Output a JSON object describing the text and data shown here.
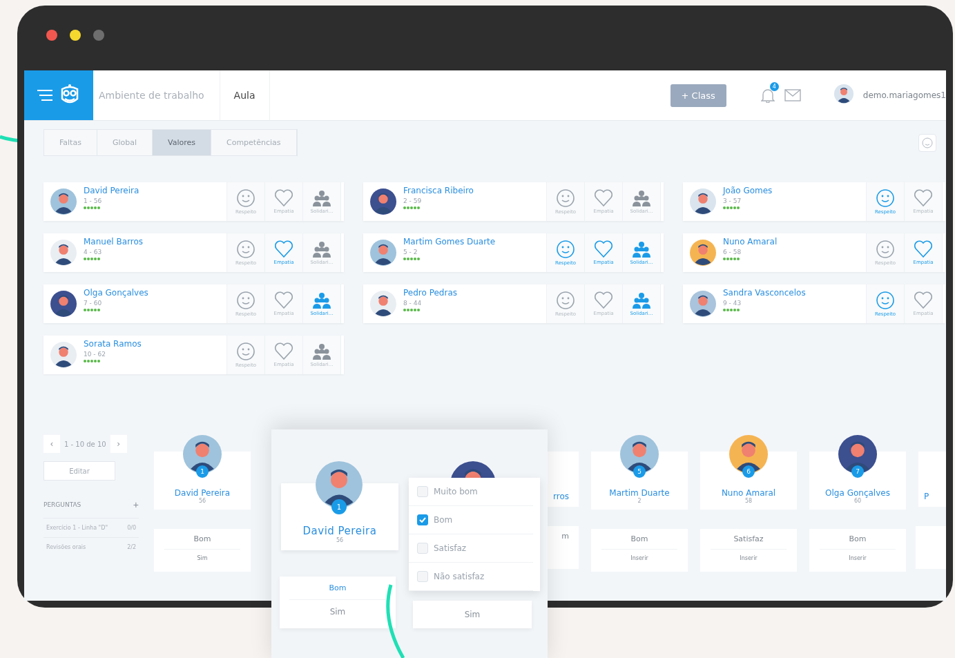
{
  "topbar": {
    "workspace": "Ambiente de trabalho",
    "section": "Aula",
    "class_button": "+ Class",
    "notifications": "4",
    "user": "demo.mariagomes1"
  },
  "tabs": [
    {
      "label": "Faltas",
      "selected": false
    },
    {
      "label": "Global",
      "selected": false
    },
    {
      "label": "Valores",
      "selected": true
    },
    {
      "label": "Competências",
      "selected": false
    }
  ],
  "students": [
    {
      "name": "David Pereira",
      "number": "1 - 56",
      "stars": 5,
      "color": "#9fc3dc",
      "values": [
        {
          "kind": "smile",
          "label": "Respeito",
          "active": false
        },
        {
          "kind": "heart",
          "label": "Empatia",
          "active": false
        },
        {
          "kind": "people",
          "label": "Solidari...",
          "active": false
        }
      ]
    },
    {
      "name": "Francisca Ribeiro",
      "number": "2 - 59",
      "stars": 5,
      "color": "#3c4f8f",
      "values": [
        {
          "kind": "smile",
          "label": "Respeito",
          "active": false
        },
        {
          "kind": "heart",
          "label": "Empatia",
          "active": false
        },
        {
          "kind": "people",
          "label": "Solidari...",
          "active": false
        }
      ]
    },
    {
      "name": "João Gomes",
      "number": "3 - 57",
      "stars": 5,
      "color": "#d9e4ee",
      "values": [
        {
          "kind": "smile",
          "label": "Respeito",
          "active": true
        },
        {
          "kind": "heart",
          "label": "Empatia",
          "active": false
        }
      ]
    },
    {
      "name": "Manuel Barros",
      "number": "4 - 63",
      "stars": 5,
      "color": "#e9eef3",
      "values": [
        {
          "kind": "smile",
          "label": "Respeito",
          "active": false
        },
        {
          "kind": "heart",
          "label": "Empatia",
          "active": true
        },
        {
          "kind": "people",
          "label": "Solidari...",
          "active": false
        }
      ]
    },
    {
      "name": "Martim Gomes Duarte",
      "number": "5 - 2",
      "stars": 5,
      "color": "#9fc3dc",
      "values": [
        {
          "kind": "smile",
          "label": "Respeito",
          "active": true
        },
        {
          "kind": "heart",
          "label": "Empatia",
          "active": true
        },
        {
          "kind": "people",
          "label": "Solidari...",
          "active": true
        }
      ]
    },
    {
      "name": "Nuno Amaral",
      "number": "6 - 58",
      "stars": 5,
      "color": "#f5b452",
      "values": [
        {
          "kind": "smile",
          "label": "Respeito",
          "active": false
        },
        {
          "kind": "heart",
          "label": "Empatia",
          "active": true
        }
      ]
    },
    {
      "name": "Olga Gonçalves",
      "number": "7 - 60",
      "stars": 5,
      "color": "#3c4f8f",
      "values": [
        {
          "kind": "smile",
          "label": "Respeito",
          "active": false
        },
        {
          "kind": "heart",
          "label": "Empatia",
          "active": false
        },
        {
          "kind": "people",
          "label": "Solidari...",
          "active": true
        }
      ]
    },
    {
      "name": "Pedro Pedras",
      "number": "8 - 44",
      "stars": 5,
      "color": "#e9eef3",
      "values": [
        {
          "kind": "smile",
          "label": "Respeito",
          "active": false
        },
        {
          "kind": "heart",
          "label": "Empatia",
          "active": false
        },
        {
          "kind": "people",
          "label": "Solidari...",
          "active": true
        }
      ]
    },
    {
      "name": "Sandra Vasconcelos",
      "number": "9 - 43",
      "stars": 5,
      "color": "#a9c4dc",
      "values": [
        {
          "kind": "smile",
          "label": "Respeito",
          "active": true
        },
        {
          "kind": "heart",
          "label": "Empatia",
          "active": false
        }
      ]
    },
    {
      "name": "Sorata Ramos",
      "number": "10 - 62",
      "stars": 5,
      "color": "#e9eef3",
      "values": [
        {
          "kind": "smile",
          "label": "Respeito",
          "active": false
        },
        {
          "kind": "heart",
          "label": "Empatia",
          "active": false
        },
        {
          "kind": "people",
          "label": "Solidari...",
          "active": false
        }
      ]
    }
  ],
  "pagination": {
    "prev": "‹",
    "range": "1 - 10 de 10",
    "next": "›"
  },
  "edit_button": "Editar",
  "questions": {
    "title": "PERGUNTAS",
    "add": "+",
    "items": [
      {
        "label": "Exercício 1 - Linha \"D\"",
        "score": "0/0"
      },
      {
        "label": "Revisões orais",
        "score": "2/2"
      }
    ]
  },
  "carousel": [
    {
      "kind": "full",
      "name": "David Pereira",
      "badge": "1",
      "number": "56",
      "color": "#9fc3dc",
      "answer": "Bom",
      "answer_2": "Sim"
    },
    {
      "kind": "partial",
      "name": "rros",
      "answer": "m"
    },
    {
      "kind": "full",
      "name": "Martim Duarte",
      "badge": "5",
      "number": "2",
      "color": "#9fc3dc",
      "answer": "Bom",
      "answer_2": "Inserir"
    },
    {
      "kind": "full",
      "name": "Nuno Amaral",
      "badge": "6",
      "number": "58",
      "color": "#f5b452",
      "answer": "Satisfaz",
      "answer_2": "Inserir"
    },
    {
      "kind": "full",
      "name": "Olga Gonçalves",
      "badge": "7",
      "number": "60",
      "color": "#3c4f8f",
      "answer": "Bom",
      "answer_2": "Inserir"
    },
    {
      "kind": "edge",
      "name": "P"
    }
  ],
  "popup": {
    "name": "David Pereira",
    "badge": "1",
    "number": "56",
    "answer": "Bom",
    "answer_2": "Sim",
    "options": [
      {
        "label": "Muito bom",
        "checked": false
      },
      {
        "label": "Bom",
        "checked": true
      },
      {
        "label": "Satisfaz",
        "checked": false
      },
      {
        "label": "Não satisfaz",
        "checked": false
      }
    ],
    "answer_right": "Sim"
  }
}
